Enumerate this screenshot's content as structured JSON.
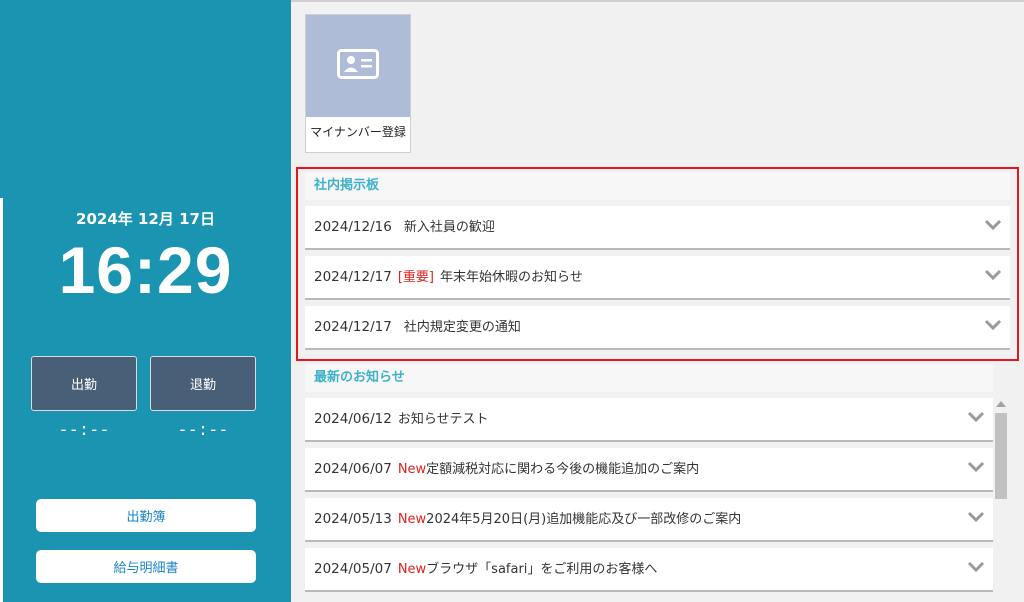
{
  "clock": {
    "date": "2024年 12月 17日",
    "time": "16:29"
  },
  "punch": {
    "in_label": "出勤",
    "out_label": "退勤",
    "in_time": "--:--",
    "out_time": "--:--"
  },
  "menu": {
    "attendance_label": "出勤簿",
    "payslip_label": "給与明細書"
  },
  "tiles": {
    "mynumber_label": "マイナンバー登録",
    "mynumber_icon": "id-card-icon"
  },
  "bulletin": {
    "title": "社内掲示板",
    "items": [
      {
        "date": "2024/12/16",
        "tag": "",
        "text": "新入社員の歓迎"
      },
      {
        "date": "2024/12/17",
        "tag": "[重要]",
        "text": "年末年始休暇のお知らせ"
      },
      {
        "date": "2024/12/17",
        "tag": "",
        "text": "社内規定変更の通知"
      }
    ]
  },
  "news": {
    "title": "最新のお知らせ",
    "items": [
      {
        "date": "2024/06/12",
        "tag": "",
        "text": "お知らせテスト"
      },
      {
        "date": "2024/06/07",
        "tag": "New",
        "text": "定額減税対応に関わる今後の機能追加のご案内"
      },
      {
        "date": "2024/05/13",
        "tag": "New",
        "text": "2024年5月20日(月)追加機能応及び一部改修のご案内"
      },
      {
        "date": "2024/05/07",
        "tag": "New",
        "text": "ブラウザ「safari」をご利用のお客様へ"
      }
    ]
  },
  "colors": {
    "sidebar": "#1b94b1",
    "punch_button": "#495f78",
    "section_title": "#3fb2c8",
    "alert_red": "#e0221e",
    "highlight_border": "#e8151b"
  }
}
